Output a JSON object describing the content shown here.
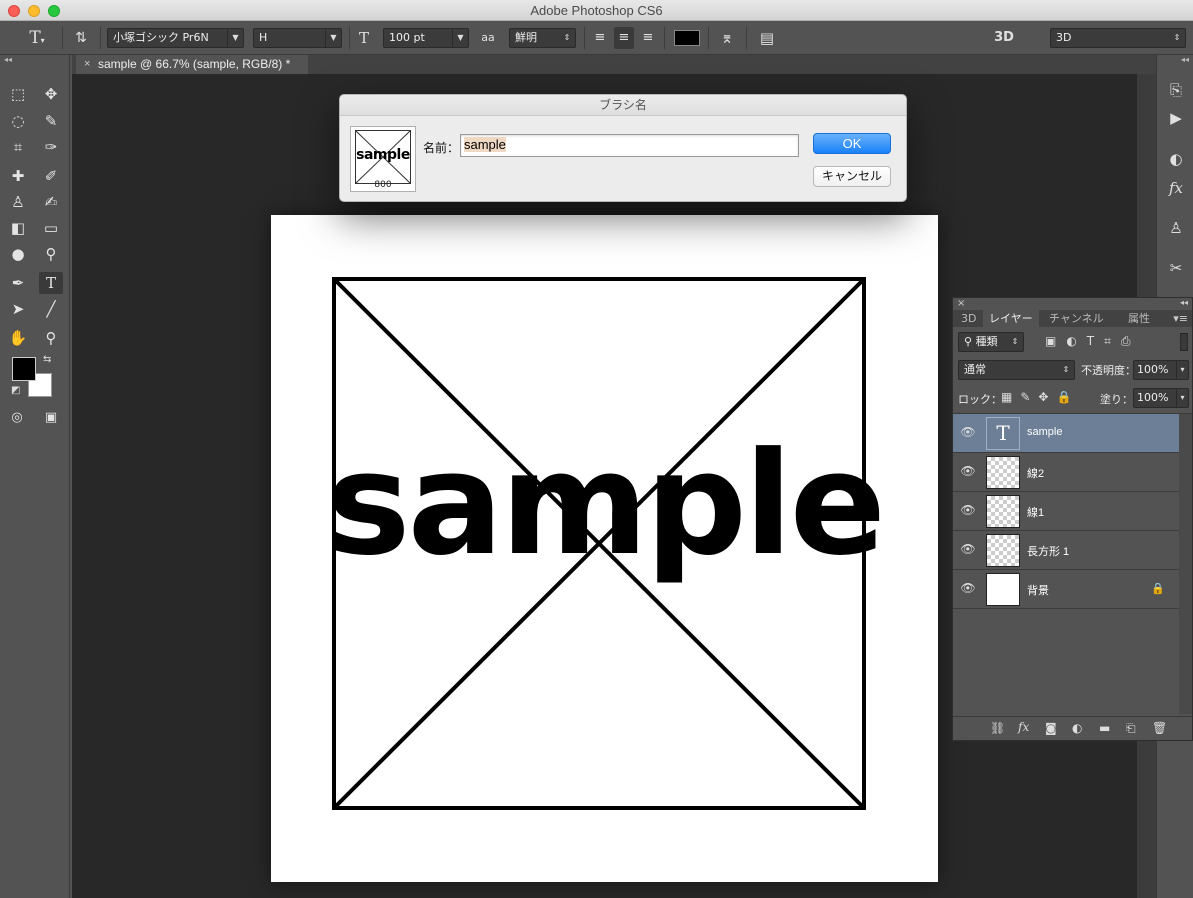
{
  "app": {
    "title": "Adobe Photoshop CS6"
  },
  "options_bar": {
    "font_family": "小塚ゴシック Pr6N",
    "font_style": "H",
    "font_size": "100 pt",
    "antialias_icon": "aa",
    "antialias": "鮮明",
    "workspace": "3D",
    "workspace_icon": "3D",
    "text_color": "#000000"
  },
  "document_tab": {
    "label": "sample @ 66.7% (sample, RGB/8) *",
    "close": "×"
  },
  "canvas": {
    "text": "sample"
  },
  "dialog": {
    "title": "ブラシ名",
    "name_label": "名前：",
    "name_value": "sample",
    "thumb_text": "sample",
    "thumb_size": "800",
    "ok_label": "OK",
    "cancel_label": "キャンセル"
  },
  "layers_panel": {
    "tabs": [
      "3D",
      "レイヤー",
      "チャンネル",
      "属性"
    ],
    "filter_label": "種類",
    "blend_mode": "通常",
    "opacity_label": "不透明度：",
    "opacity_value": "100%",
    "lock_label": "ロック：",
    "fill_label": "塗り：",
    "fill_value": "100%",
    "layers": [
      {
        "name": "sample",
        "type": "text",
        "selected": true
      },
      {
        "name": "線2",
        "type": "shape",
        "selected": false
      },
      {
        "name": "線1",
        "type": "shape",
        "selected": false
      },
      {
        "name": "長方形 1",
        "type": "shape",
        "selected": false
      },
      {
        "name": "背景",
        "type": "background",
        "selected": false,
        "locked": true
      }
    ]
  }
}
